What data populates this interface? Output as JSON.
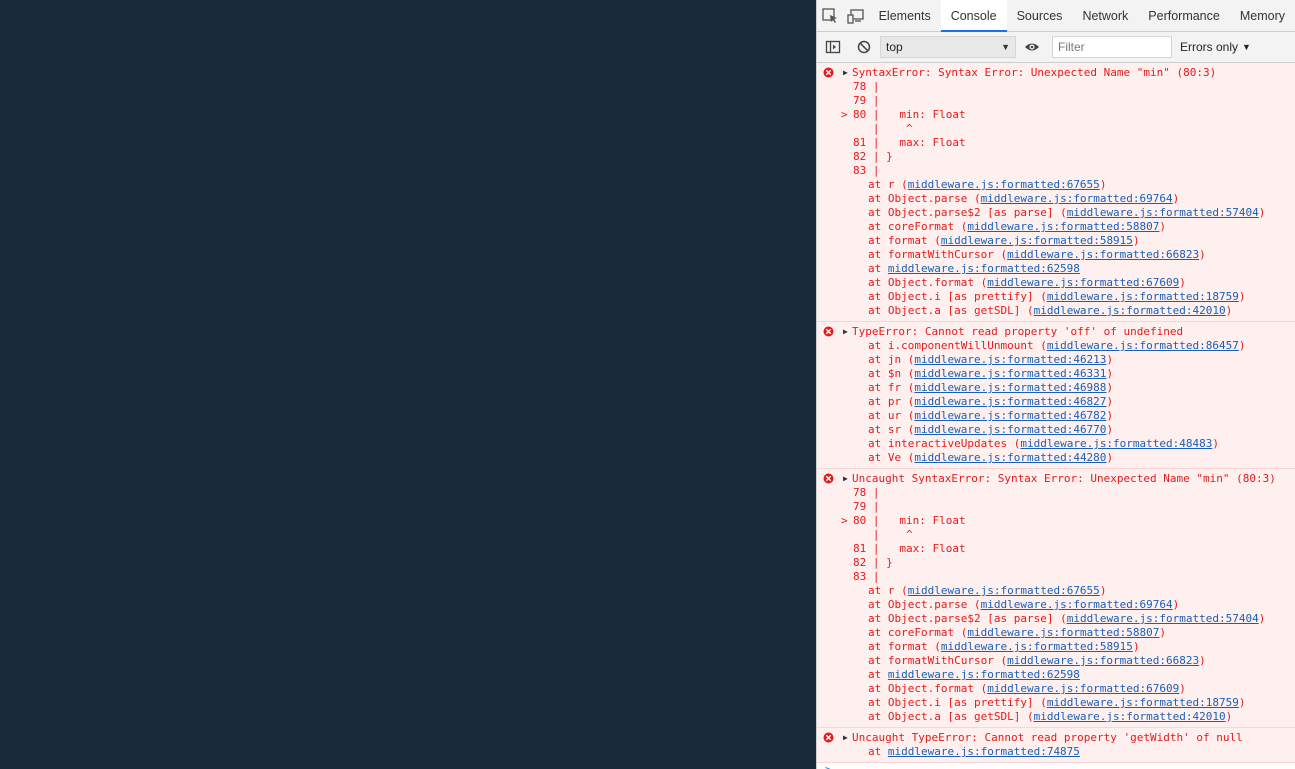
{
  "tabs": [
    {
      "label": "Elements",
      "active": false
    },
    {
      "label": "Console",
      "active": true
    },
    {
      "label": "Sources",
      "active": false
    },
    {
      "label": "Network",
      "active": false
    },
    {
      "label": "Performance",
      "active": false
    },
    {
      "label": "Memory",
      "active": false
    }
  ],
  "toolbar": {
    "context": "top",
    "filter_placeholder": "Filter",
    "level": "Errors only"
  },
  "messages": [
    {
      "head": "SyntaxError: Syntax Error: Unexpected Name \"min\" (80:3)",
      "code": [
        {
          "marker": "",
          "line": "78 |"
        },
        {
          "marker": "",
          "line": "79 |"
        },
        {
          "marker": ">",
          "line": "80 |   min: Float"
        },
        {
          "marker": "",
          "line": "   |    ^"
        },
        {
          "marker": "",
          "line": "81 |   max: Float"
        },
        {
          "marker": "",
          "line": "82 | }"
        },
        {
          "marker": "",
          "line": "83 |"
        }
      ],
      "stack": [
        {
          "fn": "r",
          "loc": "middleware.js:formatted:67655"
        },
        {
          "fn": "Object.parse",
          "loc": "middleware.js:formatted:69764"
        },
        {
          "fn": "Object.parse$2 [as parse]",
          "loc": "middleware.js:formatted:57404"
        },
        {
          "fn": "coreFormat",
          "loc": "middleware.js:formatted:58807"
        },
        {
          "fn": "format",
          "loc": "middleware.js:formatted:58915"
        },
        {
          "fn": "formatWithCursor",
          "loc": "middleware.js:formatted:66823"
        },
        {
          "fn": "",
          "loc": "middleware.js:formatted:62598"
        },
        {
          "fn": "Object.format",
          "loc": "middleware.js:formatted:67609"
        },
        {
          "fn": "Object.i [as prettify]",
          "loc": "middleware.js:formatted:18759"
        },
        {
          "fn": "Object.a [as getSDL]",
          "loc": "middleware.js:formatted:42010"
        }
      ]
    },
    {
      "head": "TypeError: Cannot read property 'off' of undefined",
      "code": [],
      "stack": [
        {
          "fn": "i.componentWillUnmount",
          "loc": "middleware.js:formatted:86457"
        },
        {
          "fn": "jn",
          "loc": "middleware.js:formatted:46213"
        },
        {
          "fn": "$n",
          "loc": "middleware.js:formatted:46331"
        },
        {
          "fn": "fr",
          "loc": "middleware.js:formatted:46988"
        },
        {
          "fn": "pr",
          "loc": "middleware.js:formatted:46827"
        },
        {
          "fn": "ur",
          "loc": "middleware.js:formatted:46782"
        },
        {
          "fn": "sr",
          "loc": "middleware.js:formatted:46770"
        },
        {
          "fn": "interactiveUpdates",
          "loc": "middleware.js:formatted:48483"
        },
        {
          "fn": "Ve",
          "loc": "middleware.js:formatted:44280"
        }
      ]
    },
    {
      "head": "Uncaught SyntaxError: Syntax Error: Unexpected Name \"min\" (80:3)",
      "code": [
        {
          "marker": "",
          "line": "78 |"
        },
        {
          "marker": "",
          "line": "79 |"
        },
        {
          "marker": ">",
          "line": "80 |   min: Float"
        },
        {
          "marker": "",
          "line": "   |    ^"
        },
        {
          "marker": "",
          "line": "81 |   max: Float"
        },
        {
          "marker": "",
          "line": "82 | }"
        },
        {
          "marker": "",
          "line": "83 |"
        }
      ],
      "stack": [
        {
          "fn": "r",
          "loc": "middleware.js:formatted:67655"
        },
        {
          "fn": "Object.parse",
          "loc": "middleware.js:formatted:69764"
        },
        {
          "fn": "Object.parse$2 [as parse]",
          "loc": "middleware.js:formatted:57404"
        },
        {
          "fn": "coreFormat",
          "loc": "middleware.js:formatted:58807"
        },
        {
          "fn": "format",
          "loc": "middleware.js:formatted:58915"
        },
        {
          "fn": "formatWithCursor",
          "loc": "middleware.js:formatted:66823"
        },
        {
          "fn": "",
          "loc": "middleware.js:formatted:62598"
        },
        {
          "fn": "Object.format",
          "loc": "middleware.js:formatted:67609"
        },
        {
          "fn": "Object.i [as prettify]",
          "loc": "middleware.js:formatted:18759"
        },
        {
          "fn": "Object.a [as getSDL]",
          "loc": "middleware.js:formatted:42010"
        }
      ]
    },
    {
      "head": "Uncaught TypeError: Cannot read property 'getWidth' of null",
      "code": [],
      "stack": [
        {
          "fn": "",
          "loc": "middleware.js:formatted:74875"
        }
      ]
    }
  ],
  "prompt_symbol": ">",
  "colors": {
    "error_text": "#e41b1b",
    "error_bg": "#fff0f0",
    "link": "#1a5fb4",
    "tab_accent": "#1a73e8",
    "page_bg": "#192a3a"
  }
}
